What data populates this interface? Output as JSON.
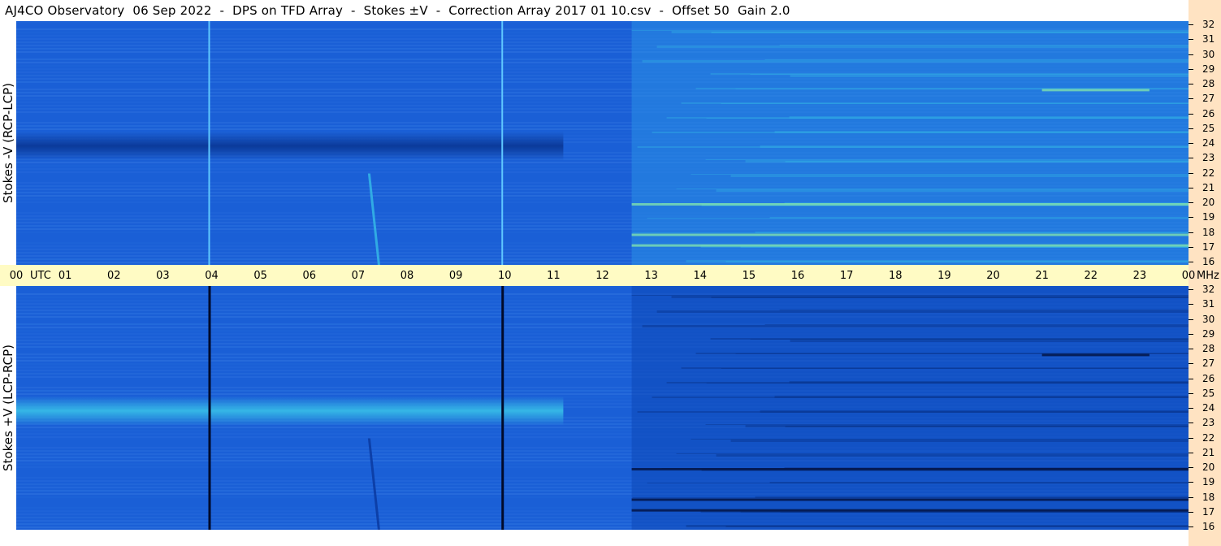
{
  "window": {
    "title": "AJ4CO Observatory  06 Sep 2022  -  DPS on TFD Array  -  Stokes ±V  -  Correction Array 2017 01 10.csv  -  Offset 50  Gain 2.0"
  },
  "panels": {
    "top_label": "Stokes -V (RCP-LCP)",
    "bottom_label": "Stokes +V (LCP-RCP)"
  },
  "axis": {
    "utc_label": "UTC",
    "mhz_label": "MHz"
  },
  "colors": {
    "background_blue": "#1a5fd6",
    "quiet_band_dark": "#0b3a9a",
    "active_cyan": "#35b7e6",
    "emission_green": "#8cf0a8",
    "axis_strip": "#fffbc4",
    "side_strip": "#ffe3c2"
  },
  "chart_data": {
    "type": "heatmap",
    "description_panels": [
      "Stokes -V (RCP-LCP)",
      "Stokes +V (LCP-RCP)"
    ],
    "x_ticks": [
      "00",
      "01",
      "02",
      "03",
      "04",
      "05",
      "06",
      "07",
      "08",
      "09",
      "10",
      "11",
      "12",
      "13",
      "14",
      "15",
      "16",
      "17",
      "18",
      "19",
      "20",
      "21",
      "22",
      "23",
      "00"
    ],
    "y_ticks": [
      "32",
      "31",
      "30",
      "29",
      "28",
      "27",
      "26",
      "25",
      "24",
      "23",
      "22",
      "21",
      "20",
      "19",
      "18",
      "17",
      "16"
    ],
    "x_range_utc_hours": [
      0,
      24
    ],
    "y_range_mhz": [
      16,
      32
    ],
    "features": {
      "vertical_lines_utc": [
        3.95,
        9.95
      ],
      "active_region_start_utc": 12.6,
      "strong_band_mhz": 23.8,
      "strong_band_end_utc": 11.2,
      "emission_bands_mhz": [
        20.0,
        18.0,
        17.3,
        27.5
      ],
      "drift_burst_utc": [
        7.2,
        7.4
      ]
    }
  }
}
